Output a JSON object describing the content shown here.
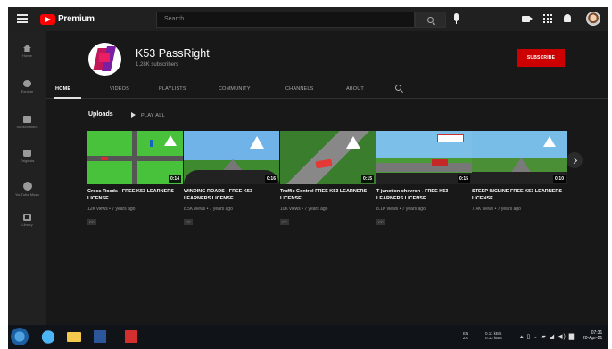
{
  "header": {
    "logo_text": "Premium",
    "search_placeholder": "Search"
  },
  "sidebar": {
    "items": [
      {
        "label": "Home",
        "icon": "home-icon"
      },
      {
        "label": "Explore",
        "icon": "compass-icon"
      },
      {
        "label": "Subscriptions",
        "icon": "subscriptions-icon"
      },
      {
        "label": "Originals",
        "icon": "originals-icon"
      },
      {
        "label": "YouTube Music",
        "icon": "music-icon"
      },
      {
        "label": "Library",
        "icon": "library-icon"
      }
    ]
  },
  "channel": {
    "name": "K53 PassRight",
    "subscribers": "1.28K subscribers",
    "subscribe_label": "SUBSCRIBE"
  },
  "tabs": [
    "HOME",
    "VIDEOS",
    "PLAYLISTS",
    "COMMUNITY",
    "CHANNELS",
    "ABOUT"
  ],
  "uploads": {
    "title": "Uploads",
    "play_all": "PLAY ALL"
  },
  "videos": [
    {
      "title": "Cross Roads - FREE K53 LEARNERS LICENSE...",
      "duration": "0:14",
      "views": "12K views",
      "age": "7 years ago",
      "badge": "CC"
    },
    {
      "title": "WINDING ROADS - FREE K53 LEARNERS LICENSE...",
      "duration": "0:16",
      "views": "8.5K views",
      "age": "7 years ago",
      "badge": "CC"
    },
    {
      "title": "Traffic Control FREE K53 LEARNERS LICENSE...",
      "duration": "0:15",
      "views": "10K views",
      "age": "7 years ago",
      "badge": "CC"
    },
    {
      "title": "T junction chevron - FREE K53 LEARNERS LICENSE...",
      "duration": "0:15",
      "views": "8.1K views",
      "age": "7 years ago",
      "badge": "CC"
    },
    {
      "title": "STEEP INCLINE FREE K53 LEARNERS LICENSE...",
      "duration": "0:10",
      "views": "7.4K views",
      "age": "7 years ago",
      "badge": ""
    }
  ],
  "taskbar": {
    "lang": "EN\nZA",
    "net_speed": "0.11 kB/s\n0.12 kB/s",
    "clock_time": "07:31",
    "clock_date": "20-Apr-21"
  },
  "colors": {
    "background": "#181818",
    "topbar": "#202020",
    "accent_red": "#cc0000"
  }
}
